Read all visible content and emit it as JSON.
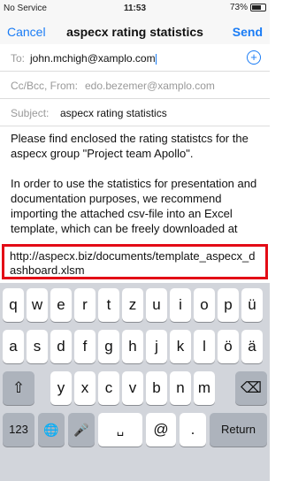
{
  "status_bar": {
    "carrier": "No Service",
    "time": "11:53",
    "battery": "73%",
    "battery_level": 0.73
  },
  "nav": {
    "cancel": "Cancel",
    "title": "aspecx rating statistics",
    "send": "Send"
  },
  "to": {
    "label": "To:",
    "value": "john.mchigh@xamplo.com"
  },
  "cc": {
    "label": "Cc/Bcc, From:",
    "value": "edo.bezemer@xamplo.com"
  },
  "subject": {
    "label": "Subject:",
    "value": "aspecx rating statistics"
  },
  "body": {
    "paragraph1": "Please find enclosed the rating statistcs for the aspecx group \"Project team Apollo\".",
    "paragraph2": "In order to use the statistics for presentation and documentation purposes, we recommend importing the attached csv-file into an Excel template, which can be freely downloaded at",
    "link": "http://aspecx.biz/documents/template_aspecx_dashboard.xlsm"
  },
  "keyboard": {
    "row1": [
      "q",
      "w",
      "e",
      "r",
      "t",
      "z",
      "u",
      "i",
      "o",
      "p",
      "ü"
    ],
    "row2": [
      "a",
      "s",
      "d",
      "f",
      "g",
      "h",
      "j",
      "k",
      "l",
      "ö",
      "ä"
    ],
    "row3": [
      "y",
      "x",
      "c",
      "v",
      "b",
      "n",
      "m"
    ],
    "numbers": "123",
    "space": "␣",
    "at": "@",
    "dot": ".",
    "return": "Return",
    "shift_icon": "⇧",
    "delete_icon": "⌫",
    "globe_icon": "🌐",
    "mic_icon": "🎤"
  }
}
